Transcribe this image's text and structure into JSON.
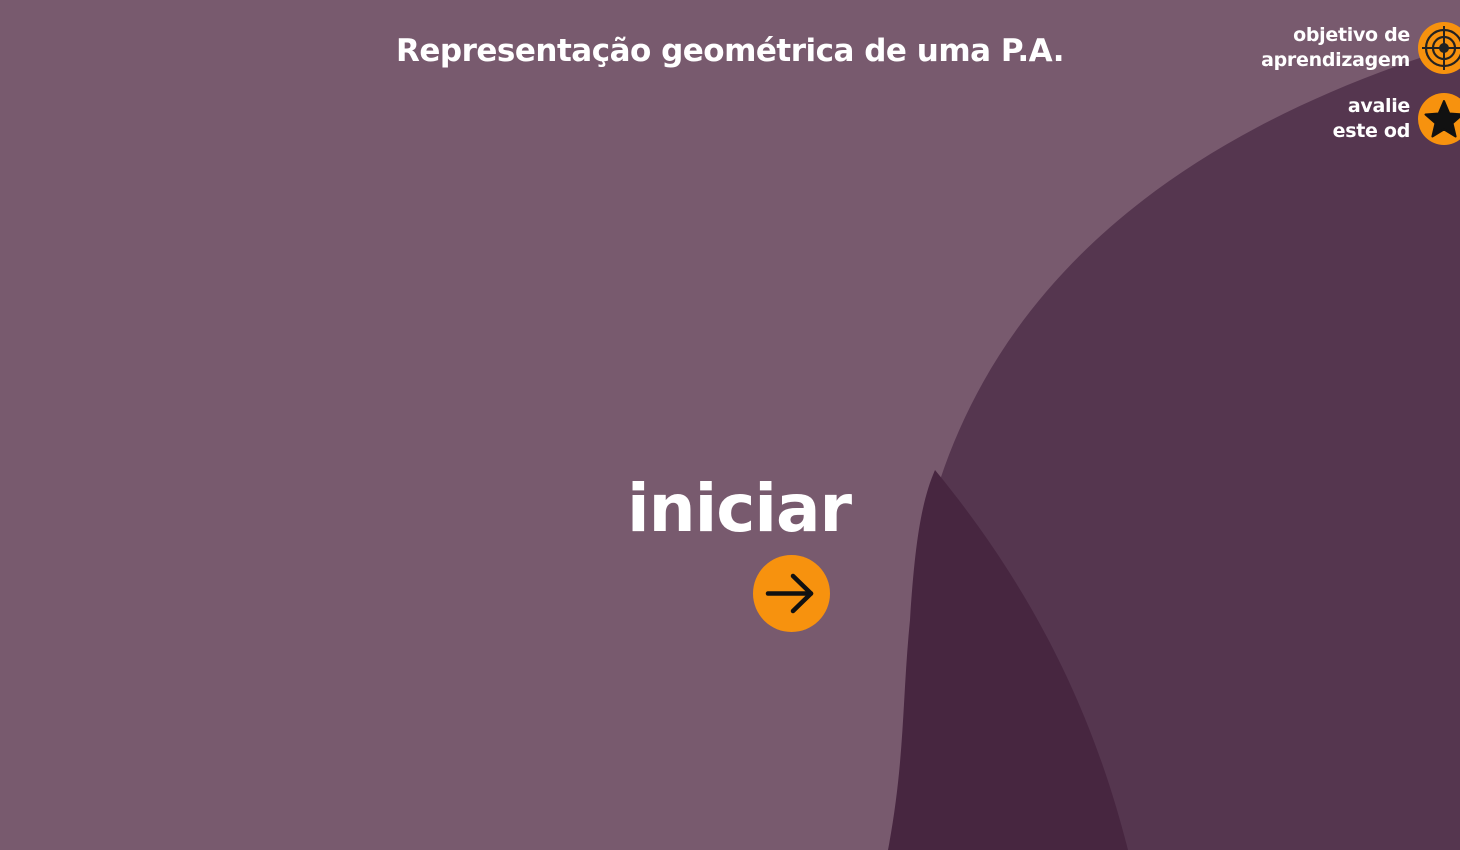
{
  "header": {
    "title": "Representação geométrica de uma P.A."
  },
  "top_links": {
    "objective": {
      "line1": "objetivo de",
      "line2": "aprendizagem",
      "icon": "target-icon"
    },
    "rate": {
      "line1": "avalie",
      "line2": "este od",
      "icon": "star-icon"
    }
  },
  "start": {
    "label": "iniciar",
    "icon": "arrow-right-icon"
  },
  "colors": {
    "background": "#785a6e",
    "shape_mid": "#55364f",
    "shape_dark": "#472640",
    "accent": "#f7920e",
    "text": "#ffffff"
  }
}
